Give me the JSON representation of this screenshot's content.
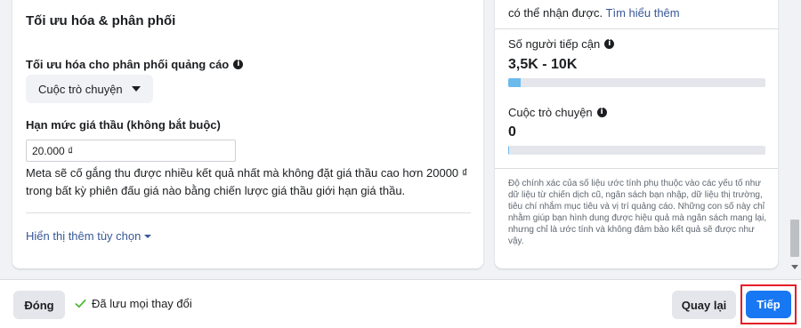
{
  "optimization": {
    "section_title": "Tối ưu hóa & phân phối",
    "delivery_label": "Tối ưu hóa cho phân phối quảng cáo",
    "delivery_value": "Cuộc trò chuyện",
    "bid_label": "Hạn mức giá thầu (không bắt buộc)",
    "bid_value": "20.000 ₫",
    "helper_text": "Meta sẽ cố gắng thu được nhiều kết quả nhất mà không đặt giá thầu cao hơn 20000 ₫ trong bất kỳ phiên đấu giá nào bằng chiến lược giá thầu giới hạn giá thầu.",
    "show_more_link": "Hiển thị thêm tùy chọn"
  },
  "estimates": {
    "top_text": "có thể nhận được.",
    "learn_more": "Tìm hiểu thêm",
    "reach_label": "Số người tiếp cận",
    "reach_value": "3,5K - 10K",
    "reach_fill": 0.05,
    "conversations_label": "Cuộc trò chuyện",
    "conversations_value": "0",
    "conversations_fill": 0.005,
    "disclaimer": "Độ chính xác của số liệu ước tính phụ thuộc vào các yếu tố như dữ liệu từ chiến dịch cũ, ngân sách bạn nhập, dữ liệu thị trường, tiêu chí nhắm mục tiêu và vị trí quảng cáo. Những con số này chỉ nhằm giúp bạn hình dung được hiệu quả mà ngân sách mang lại, nhưng chỉ là ước tính và không đảm bảo kết quả sẽ được như vậy."
  },
  "footer": {
    "close_label": "Đóng",
    "saved_status": "Đã lưu mọi thay đổi",
    "back_label": "Quay lại",
    "next_label": "Tiếp"
  },
  "colors": {
    "accent": "#1877f2",
    "bar": "#6bbaec",
    "highlight": "#e41e26"
  }
}
